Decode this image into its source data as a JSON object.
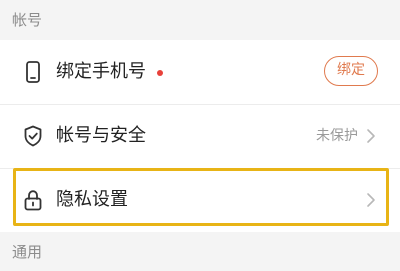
{
  "sections": {
    "account_header": "帐号",
    "general_header": "通用"
  },
  "rows": [
    {
      "icon": "phone-icon",
      "label": "绑定手机号",
      "has_red_dot": true,
      "action_label": "绑定"
    },
    {
      "icon": "shield-icon",
      "label": "帐号与安全",
      "status": "未保护"
    },
    {
      "icon": "lock-icon",
      "label": "隐私设置",
      "highlighted": true
    }
  ],
  "colors": {
    "accent": "#e07a4e",
    "red_dot": "#e8413a",
    "highlight": "#e8b416",
    "muted_text": "#9a9a9a"
  }
}
